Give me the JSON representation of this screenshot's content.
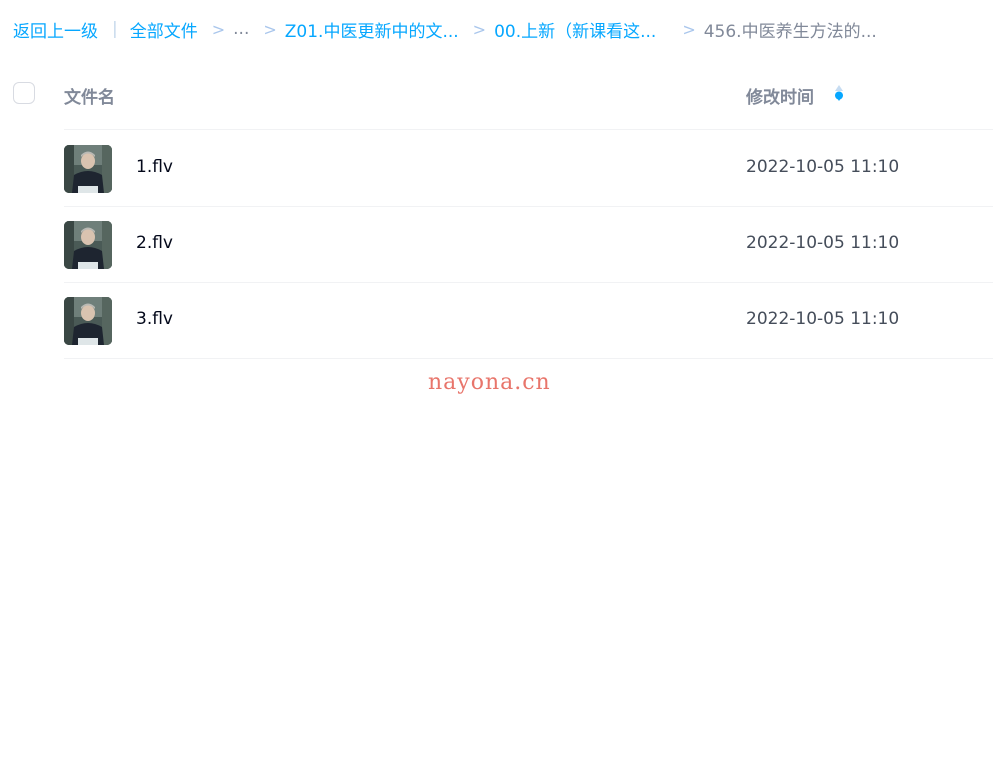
{
  "breadcrumb": {
    "back": "返回上一级",
    "pipe": "|",
    "items": [
      "全部文件",
      "...",
      "Z01.中医更新中的文...",
      "00.上新（新课看这..."
    ],
    "current": "456.中医养生方法的...",
    "separator": ">"
  },
  "header": {
    "name_label": "文件名",
    "time_label": "修改时间"
  },
  "files": [
    {
      "name": "1.flv",
      "modified": "2022-10-05 11:10"
    },
    {
      "name": "2.flv",
      "modified": "2022-10-05 11:10"
    },
    {
      "name": "3.flv",
      "modified": "2022-10-05 11:10"
    }
  ],
  "watermark": "nayona.cn",
  "colors": {
    "link": "#06a7ff",
    "muted": "#818999",
    "separator": "#a9c6ec",
    "text": "#03081a",
    "time": "#454d5a",
    "watermark": "#e8756b"
  }
}
